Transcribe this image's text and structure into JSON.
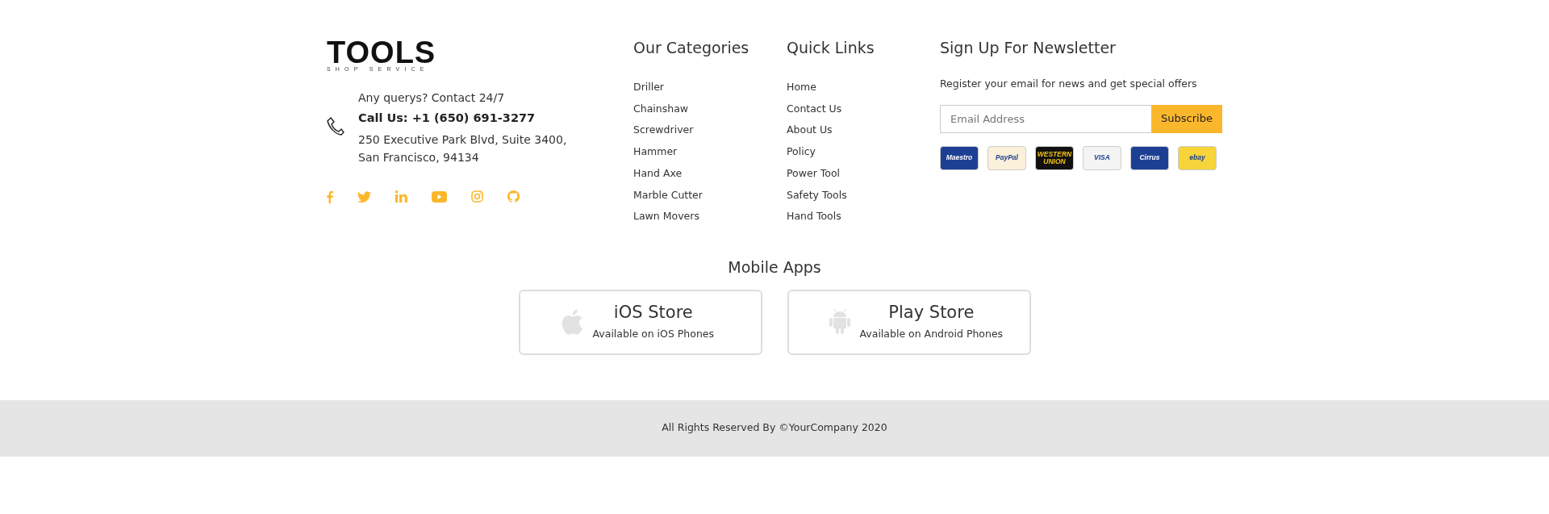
{
  "brand": {
    "name": "TOOLS",
    "tagline": "SHOP SERVICE"
  },
  "contact": {
    "query": "Any querys? Contact 24/7",
    "call": "Call Us: +1 (650) 691-3277",
    "address": [
      "250 Executive Park Blvd, Suite 3400,",
      "San Francisco, 94134"
    ]
  },
  "categories": {
    "title": "Our Categories",
    "items": [
      "Driller",
      "Chainshaw",
      "Screwdriver",
      "Hammer",
      "Hand Axe",
      "Marble Cutter",
      "Lawn Movers"
    ]
  },
  "quick_links": {
    "title": "Quick Links",
    "items": [
      "Home",
      "Contact Us",
      "About Us",
      "Policy",
      "Power Tool",
      "Safety Tools",
      "Hand Tools"
    ]
  },
  "newsletter": {
    "title": "Sign Up For Newsletter",
    "text": "Register your email for news and get special offers",
    "placeholder": "Email Address",
    "button": "Subscribe",
    "payments": [
      {
        "label": "Maestro",
        "color": "#1c3f94"
      },
      {
        "label": "PayPal",
        "color": "#fbf0d9"
      },
      {
        "label": "WESTERN UNION",
        "color": "#111111"
      },
      {
        "label": "VISA",
        "color": "#f4f4f4"
      },
      {
        "label": "Cirrus",
        "color": "#1c3f94"
      },
      {
        "label": "ebay",
        "color": "#f6d43a"
      }
    ]
  },
  "mobile_apps": {
    "title": "Mobile Apps",
    "apps": [
      {
        "kind": "ios",
        "title": "iOS Store",
        "subtitle": "Available on iOS Phones"
      },
      {
        "kind": "android",
        "title": "Play Store",
        "subtitle": "Available on Android Phones"
      }
    ]
  },
  "copyright": "All Rights Reserved By ©YourCompany 2020"
}
